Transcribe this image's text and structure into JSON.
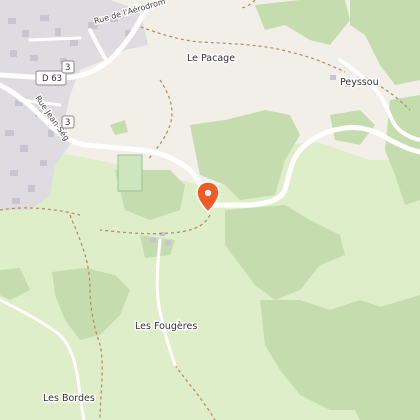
{
  "map": {
    "labels": {
      "rue_aerodrome": "Rue de l'Aérodrom",
      "le_pacage": "Le Pacage",
      "peyssou": "Peyssou",
      "rue_jean": "Rue Jean-Ség",
      "les_fougeres": "Les Fougères",
      "les_bordes": "Les Bordes"
    },
    "road_shields": {
      "d63": "D 63",
      "partial_top": "3",
      "partial_mid": "3"
    },
    "marker": {
      "icon": "map-pin-icon",
      "color": "#f15a24"
    },
    "colors": {
      "background": "#f2efe9",
      "forest": "#c5dcae",
      "meadow": "#ddeec9",
      "urban": "#dedbe1",
      "building": "#c9c5d0",
      "road": "#ffffff",
      "path": "#b08a5a"
    }
  }
}
